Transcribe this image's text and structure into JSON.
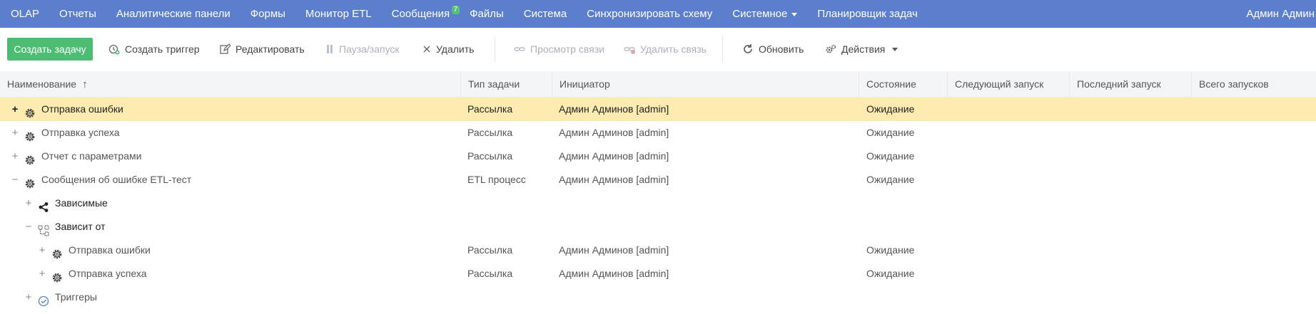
{
  "nav": {
    "items": [
      {
        "label": "OLAP"
      },
      {
        "label": "Отчеты"
      },
      {
        "label": "Аналитические панели"
      },
      {
        "label": "Формы"
      },
      {
        "label": "Монитор ETL"
      },
      {
        "label": "Сообщения",
        "badge": "7"
      },
      {
        "label": "Файлы"
      },
      {
        "label": "Система"
      },
      {
        "label": "Синхронизировать схему"
      },
      {
        "label": "Системное",
        "dropdown": true
      },
      {
        "label": "Планировщик задач"
      }
    ],
    "user": "Админ Админ"
  },
  "toolbar": {
    "create_task": "Создать задачу",
    "create_trigger": "Создать триггер",
    "edit": "Редактировать",
    "pause": "Пауза/запуск",
    "delete": "Удалить",
    "view_link": "Просмотр связи",
    "delete_link": "Удалить связь",
    "refresh": "Обновить",
    "actions": "Действия"
  },
  "table": {
    "headers": {
      "name": "Наименование",
      "type": "Тип задачи",
      "initiator": "Инициатор",
      "state": "Состояние",
      "next_run": "Следующий запуск",
      "last_run": "Последний запуск",
      "total_runs": "Всего запусков"
    },
    "rows": [
      {
        "toggle": "+",
        "icon": "gear-icon",
        "name": "Отправка ошибки",
        "type": "Рассылка",
        "initiator": "Админ Админов [admin]",
        "state": "Ожидание"
      },
      {
        "toggle": "+",
        "icon": "gear-icon",
        "name": "Отправка успеха",
        "type": "Рассылка",
        "initiator": "Админ Админов [admin]",
        "state": "Ожидание"
      },
      {
        "toggle": "+",
        "icon": "gear-icon",
        "name": "Отчет с параметрами",
        "type": "Рассылка",
        "initiator": "Админ Админов [admin]",
        "state": "Ожидание"
      },
      {
        "toggle": "−",
        "icon": "gear-icon",
        "name": "Сообщения об ошибке ETL-тест",
        "type": "ETL процесс",
        "initiator": "Админ Админов [admin]",
        "state": "Ожидание"
      },
      {
        "toggle": "+",
        "icon": "share-icon",
        "name": "Зависимые",
        "type": "",
        "initiator": "",
        "state": ""
      },
      {
        "toggle": "−",
        "icon": "dependency-icon",
        "name": "Зависит от",
        "type": "",
        "initiator": "",
        "state": ""
      },
      {
        "toggle": "+",
        "icon": "gear-icon",
        "name": "Отправка ошибки",
        "type": "Рассылка",
        "initiator": "Админ Админов [admin]",
        "state": "Ожидание"
      },
      {
        "toggle": "+",
        "icon": "gear-icon",
        "name": "Отправка успеха",
        "type": "Рассылка",
        "initiator": "Админ Админов [admin]",
        "state": "Ожидание"
      },
      {
        "toggle": "+",
        "icon": "clock-icon",
        "name": "Триггеры",
        "type": "",
        "initiator": "",
        "state": ""
      }
    ]
  }
}
